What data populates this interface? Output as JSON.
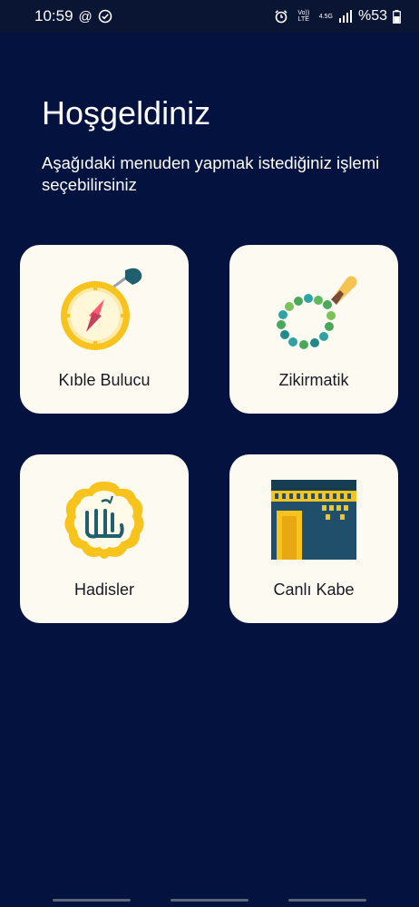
{
  "status_bar": {
    "time": "10:59",
    "at_symbol": "@",
    "volte_label": "Vo)) LTE",
    "network_label": "4.5G",
    "battery": "%53"
  },
  "header": {
    "title": "Hoşgeldiniz",
    "subtitle": "Aşağıdaki menuden yapmak istediğiniz işlemi seçebilirsiniz"
  },
  "menu": {
    "items": [
      {
        "label": "Kıble Bulucu",
        "icon": "compass-icon"
      },
      {
        "label": "Zikirmatik",
        "icon": "prayer-beads-icon"
      },
      {
        "label": "Hadisler",
        "icon": "allah-calligraphy-icon"
      },
      {
        "label": "Canlı Kabe",
        "icon": "kaaba-icon"
      }
    ]
  },
  "colors": {
    "background": "#03123f",
    "card": "#fdfaf2",
    "accent_yellow": "#f7c31c",
    "accent_teal": "#1f5f6e"
  }
}
